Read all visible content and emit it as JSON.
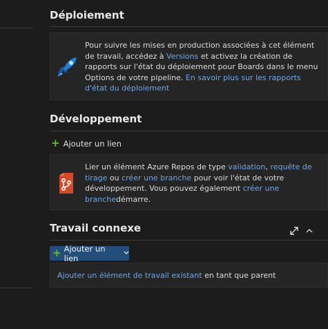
{
  "deployment": {
    "title": "Déploiement",
    "text_1": "Pour suivre les mises en production associées à cet élément de travail, accédez à ",
    "versions_link": "Versions",
    "text_2": " et activez la création de rapports sur l'état du déploiement pour Boards dans le menu Options de votre pipeline. ",
    "learn_more_link": "En savoir plus sur les rapports d'état du déploiement"
  },
  "development": {
    "title": "Développement",
    "add_link_label": "Ajouter un lien",
    "text_1": "Lier un élément Azure Repos de type ",
    "validation_link": "validation",
    "comma": ", ",
    "pull_request_link": "requête de tirage",
    "or_text": " ou ",
    "create_branch_link": "créer une branche",
    "text_2": " pour voir l'état de votre développement. Vous pouvez également ",
    "create_branch_link_2": "créer une branche",
    "text_3": "démarre."
  },
  "related": {
    "title": "Travail connexe",
    "add_link_button_label": "Ajouter un lien",
    "add_existing_link": "Ajouter un élément de travail existant",
    "as_parent_text": " en tant que parent"
  },
  "colors": {
    "background": "#1c1c1c",
    "card": "#252526",
    "link": "#6ea6e6",
    "button": "#254d79",
    "plus": "#6cbc3e"
  },
  "icons": [
    "rocket-icon",
    "plus-icon",
    "git-branch-icon",
    "chevron-down-icon",
    "expand-icon",
    "chevron-up-icon"
  ]
}
